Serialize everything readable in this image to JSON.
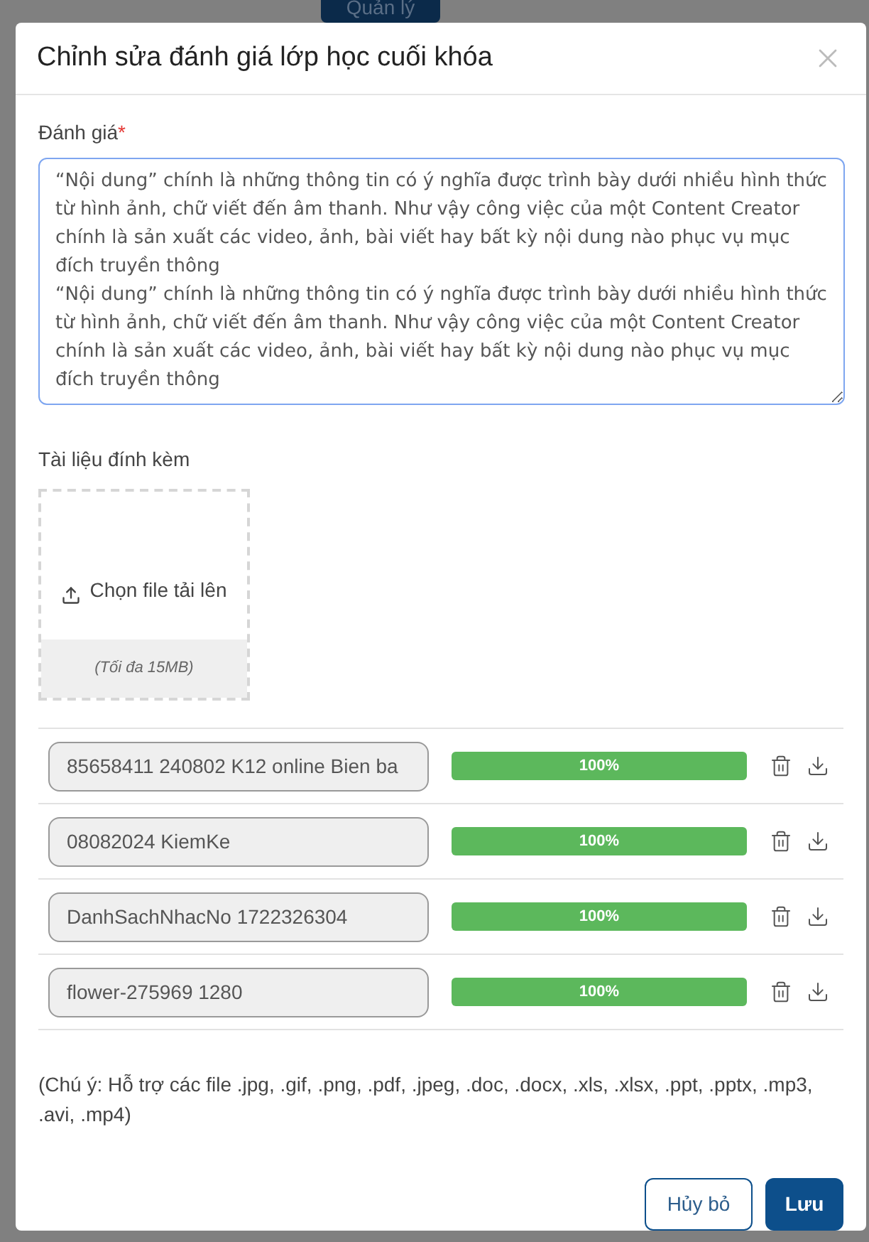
{
  "background": {
    "button": "Quản lý"
  },
  "dialog": {
    "title": "Chỉnh sửa đánh giá lớp học cuối khóa",
    "review": {
      "label": "Đánh giá",
      "required_mark": "*",
      "value": "“Nội dung” chính là những thông tin có ý nghĩa được trình bày dưới nhiều hình thức từ hình ảnh, chữ viết đến âm thanh. Như vậy công việc của một Content Creator chính là sản xuất các video, ảnh, bài viết hay bất kỳ nội dung nào phục vụ mục đích truyền thông\n“Nội dung” chính là những thông tin có ý nghĩa được trình bày dưới nhiều hình thức từ hình ảnh, chữ viết đến âm thanh. Như vậy công việc của một Content Creator chính là sản xuất các video, ảnh, bài viết hay bất kỳ nội dung nào phục vụ mục đích truyền thông"
    },
    "attachments": {
      "label": "Tài liệu đính kèm",
      "upload": "Chọn file tải lên",
      "limit": "(Tối đa 15MB)",
      "files": [
        {
          "name": "85658411 240802 K12 online Bien ba",
          "level": 1,
          "reading": "100%"
        },
        {
          "name": "08082024 KiemKe",
          "level": 1,
          "reading": "100%"
        },
        {
          "name": "DanhSachNhacNo 1722326304",
          "level": 1,
          "reading": "100%"
        },
        {
          "name": "flower-275969 1280",
          "level": 1,
          "reading": "100%"
        }
      ]
    },
    "note": "(Chú ý: Hỗ trợ các file .jpg, .gif, .png, .pdf, .jpeg, .doc, .docx, .xls, .xlsx, .ppt, .pptx, .mp3, .avi, .mp4)",
    "buttons": {
      "cancel": "Hủy bỏ",
      "save": "Lưu"
    }
  }
}
